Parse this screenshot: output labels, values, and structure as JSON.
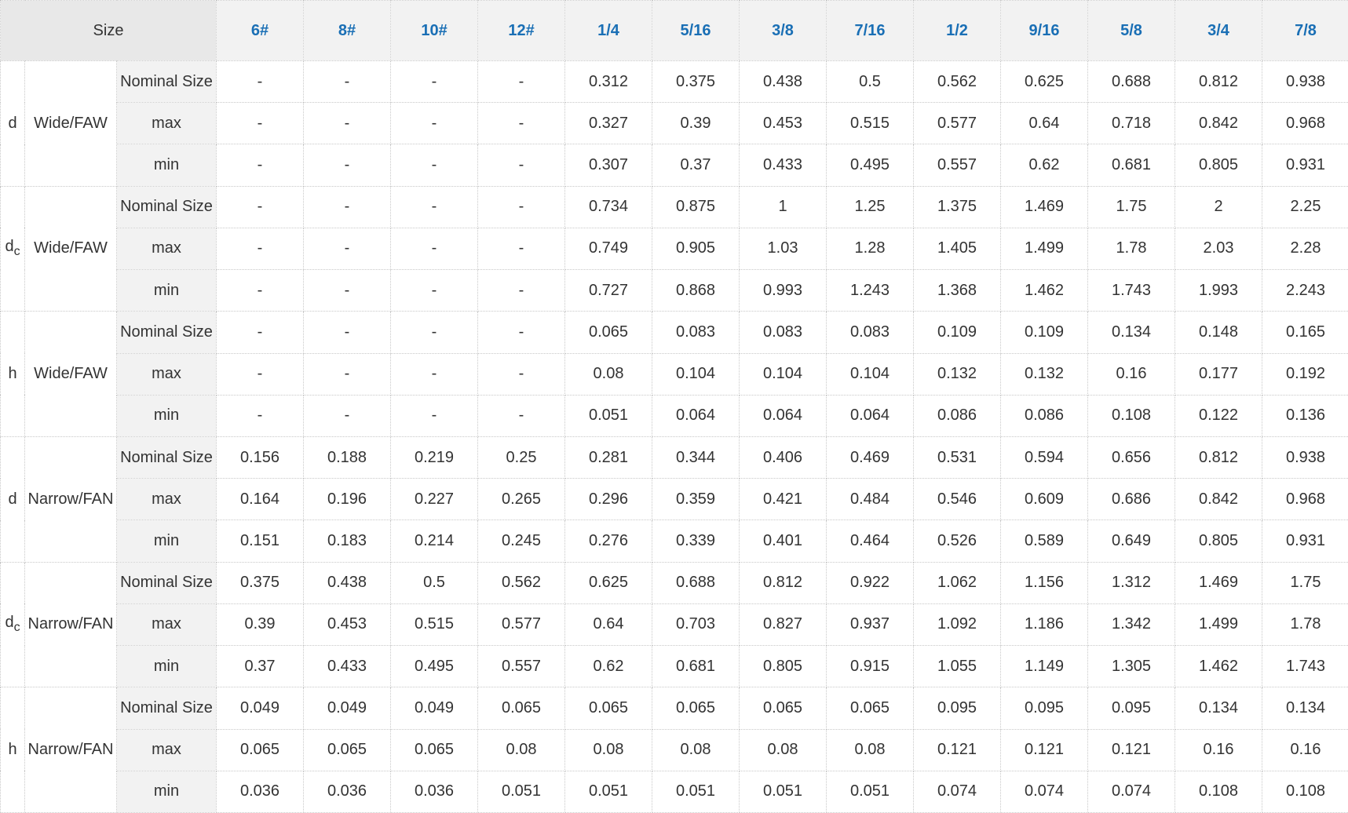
{
  "table": {
    "size_label": "Size",
    "columns": [
      "6#",
      "8#",
      "10#",
      "12#",
      "1/4",
      "5/16",
      "3/8",
      "7/16",
      "1/2",
      "9/16",
      "5/8",
      "3/4",
      "7/8"
    ],
    "groups": [
      {
        "symbol": "d",
        "sub": "",
        "type": "Wide/FAW",
        "rows": [
          {
            "label": "Nominal Size",
            "values": [
              "-",
              "-",
              "-",
              "-",
              "0.312",
              "0.375",
              "0.438",
              "0.5",
              "0.562",
              "0.625",
              "0.688",
              "0.812",
              "0.938"
            ]
          },
          {
            "label": "max",
            "values": [
              "-",
              "-",
              "-",
              "-",
              "0.327",
              "0.39",
              "0.453",
              "0.515",
              "0.577",
              "0.64",
              "0.718",
              "0.842",
              "0.968"
            ]
          },
          {
            "label": "min",
            "values": [
              "-",
              "-",
              "-",
              "-",
              "0.307",
              "0.37",
              "0.433",
              "0.495",
              "0.557",
              "0.62",
              "0.681",
              "0.805",
              "0.931"
            ]
          }
        ]
      },
      {
        "symbol": "d",
        "sub": "c",
        "type": "Wide/FAW",
        "rows": [
          {
            "label": "Nominal Size",
            "values": [
              "-",
              "-",
              "-",
              "-",
              "0.734",
              "0.875",
              "1",
              "1.25",
              "1.375",
              "1.469",
              "1.75",
              "2",
              "2.25"
            ]
          },
          {
            "label": "max",
            "values": [
              "-",
              "-",
              "-",
              "-",
              "0.749",
              "0.905",
              "1.03",
              "1.28",
              "1.405",
              "1.499",
              "1.78",
              "2.03",
              "2.28"
            ]
          },
          {
            "label": "min",
            "values": [
              "-",
              "-",
              "-",
              "-",
              "0.727",
              "0.868",
              "0.993",
              "1.243",
              "1.368",
              "1.462",
              "1.743",
              "1.993",
              "2.243"
            ]
          }
        ]
      },
      {
        "symbol": "h",
        "sub": "",
        "type": "Wide/FAW",
        "rows": [
          {
            "label": "Nominal Size",
            "values": [
              "-",
              "-",
              "-",
              "-",
              "0.065",
              "0.083",
              "0.083",
              "0.083",
              "0.109",
              "0.109",
              "0.134",
              "0.148",
              "0.165"
            ]
          },
          {
            "label": "max",
            "values": [
              "-",
              "-",
              "-",
              "-",
              "0.08",
              "0.104",
              "0.104",
              "0.104",
              "0.132",
              "0.132",
              "0.16",
              "0.177",
              "0.192"
            ]
          },
          {
            "label": "min",
            "values": [
              "-",
              "-",
              "-",
              "-",
              "0.051",
              "0.064",
              "0.064",
              "0.064",
              "0.086",
              "0.086",
              "0.108",
              "0.122",
              "0.136"
            ]
          }
        ]
      },
      {
        "symbol": "d",
        "sub": "",
        "type": "Narrow/FAN",
        "rows": [
          {
            "label": "Nominal Size",
            "values": [
              "0.156",
              "0.188",
              "0.219",
              "0.25",
              "0.281",
              "0.344",
              "0.406",
              "0.469",
              "0.531",
              "0.594",
              "0.656",
              "0.812",
              "0.938"
            ]
          },
          {
            "label": "max",
            "values": [
              "0.164",
              "0.196",
              "0.227",
              "0.265",
              "0.296",
              "0.359",
              "0.421",
              "0.484",
              "0.546",
              "0.609",
              "0.686",
              "0.842",
              "0.968"
            ]
          },
          {
            "label": "min",
            "values": [
              "0.151",
              "0.183",
              "0.214",
              "0.245",
              "0.276",
              "0.339",
              "0.401",
              "0.464",
              "0.526",
              "0.589",
              "0.649",
              "0.805",
              "0.931"
            ]
          }
        ]
      },
      {
        "symbol": "d",
        "sub": "c",
        "type": "Narrow/FAN",
        "rows": [
          {
            "label": "Nominal Size",
            "values": [
              "0.375",
              "0.438",
              "0.5",
              "0.562",
              "0.625",
              "0.688",
              "0.812",
              "0.922",
              "1.062",
              "1.156",
              "1.312",
              "1.469",
              "1.75"
            ]
          },
          {
            "label": "max",
            "values": [
              "0.39",
              "0.453",
              "0.515",
              "0.577",
              "0.64",
              "0.703",
              "0.827",
              "0.937",
              "1.092",
              "1.186",
              "1.342",
              "1.499",
              "1.78"
            ]
          },
          {
            "label": "min",
            "values": [
              "0.37",
              "0.433",
              "0.495",
              "0.557",
              "0.62",
              "0.681",
              "0.805",
              "0.915",
              "1.055",
              "1.149",
              "1.305",
              "1.462",
              "1.743"
            ]
          }
        ]
      },
      {
        "symbol": "h",
        "sub": "",
        "type": "Narrow/FAN",
        "rows": [
          {
            "label": "Nominal Size",
            "values": [
              "0.049",
              "0.049",
              "0.049",
              "0.065",
              "0.065",
              "0.065",
              "0.065",
              "0.065",
              "0.095",
              "0.095",
              "0.095",
              "0.134",
              "0.134"
            ]
          },
          {
            "label": "max",
            "values": [
              "0.065",
              "0.065",
              "0.065",
              "0.08",
              "0.08",
              "0.08",
              "0.08",
              "0.08",
              "0.121",
              "0.121",
              "0.121",
              "0.16",
              "0.16"
            ]
          },
          {
            "label": "min",
            "values": [
              "0.036",
              "0.036",
              "0.036",
              "0.051",
              "0.051",
              "0.051",
              "0.051",
              "0.051",
              "0.074",
              "0.074",
              "0.074",
              "0.108",
              "0.108"
            ]
          }
        ]
      }
    ]
  }
}
